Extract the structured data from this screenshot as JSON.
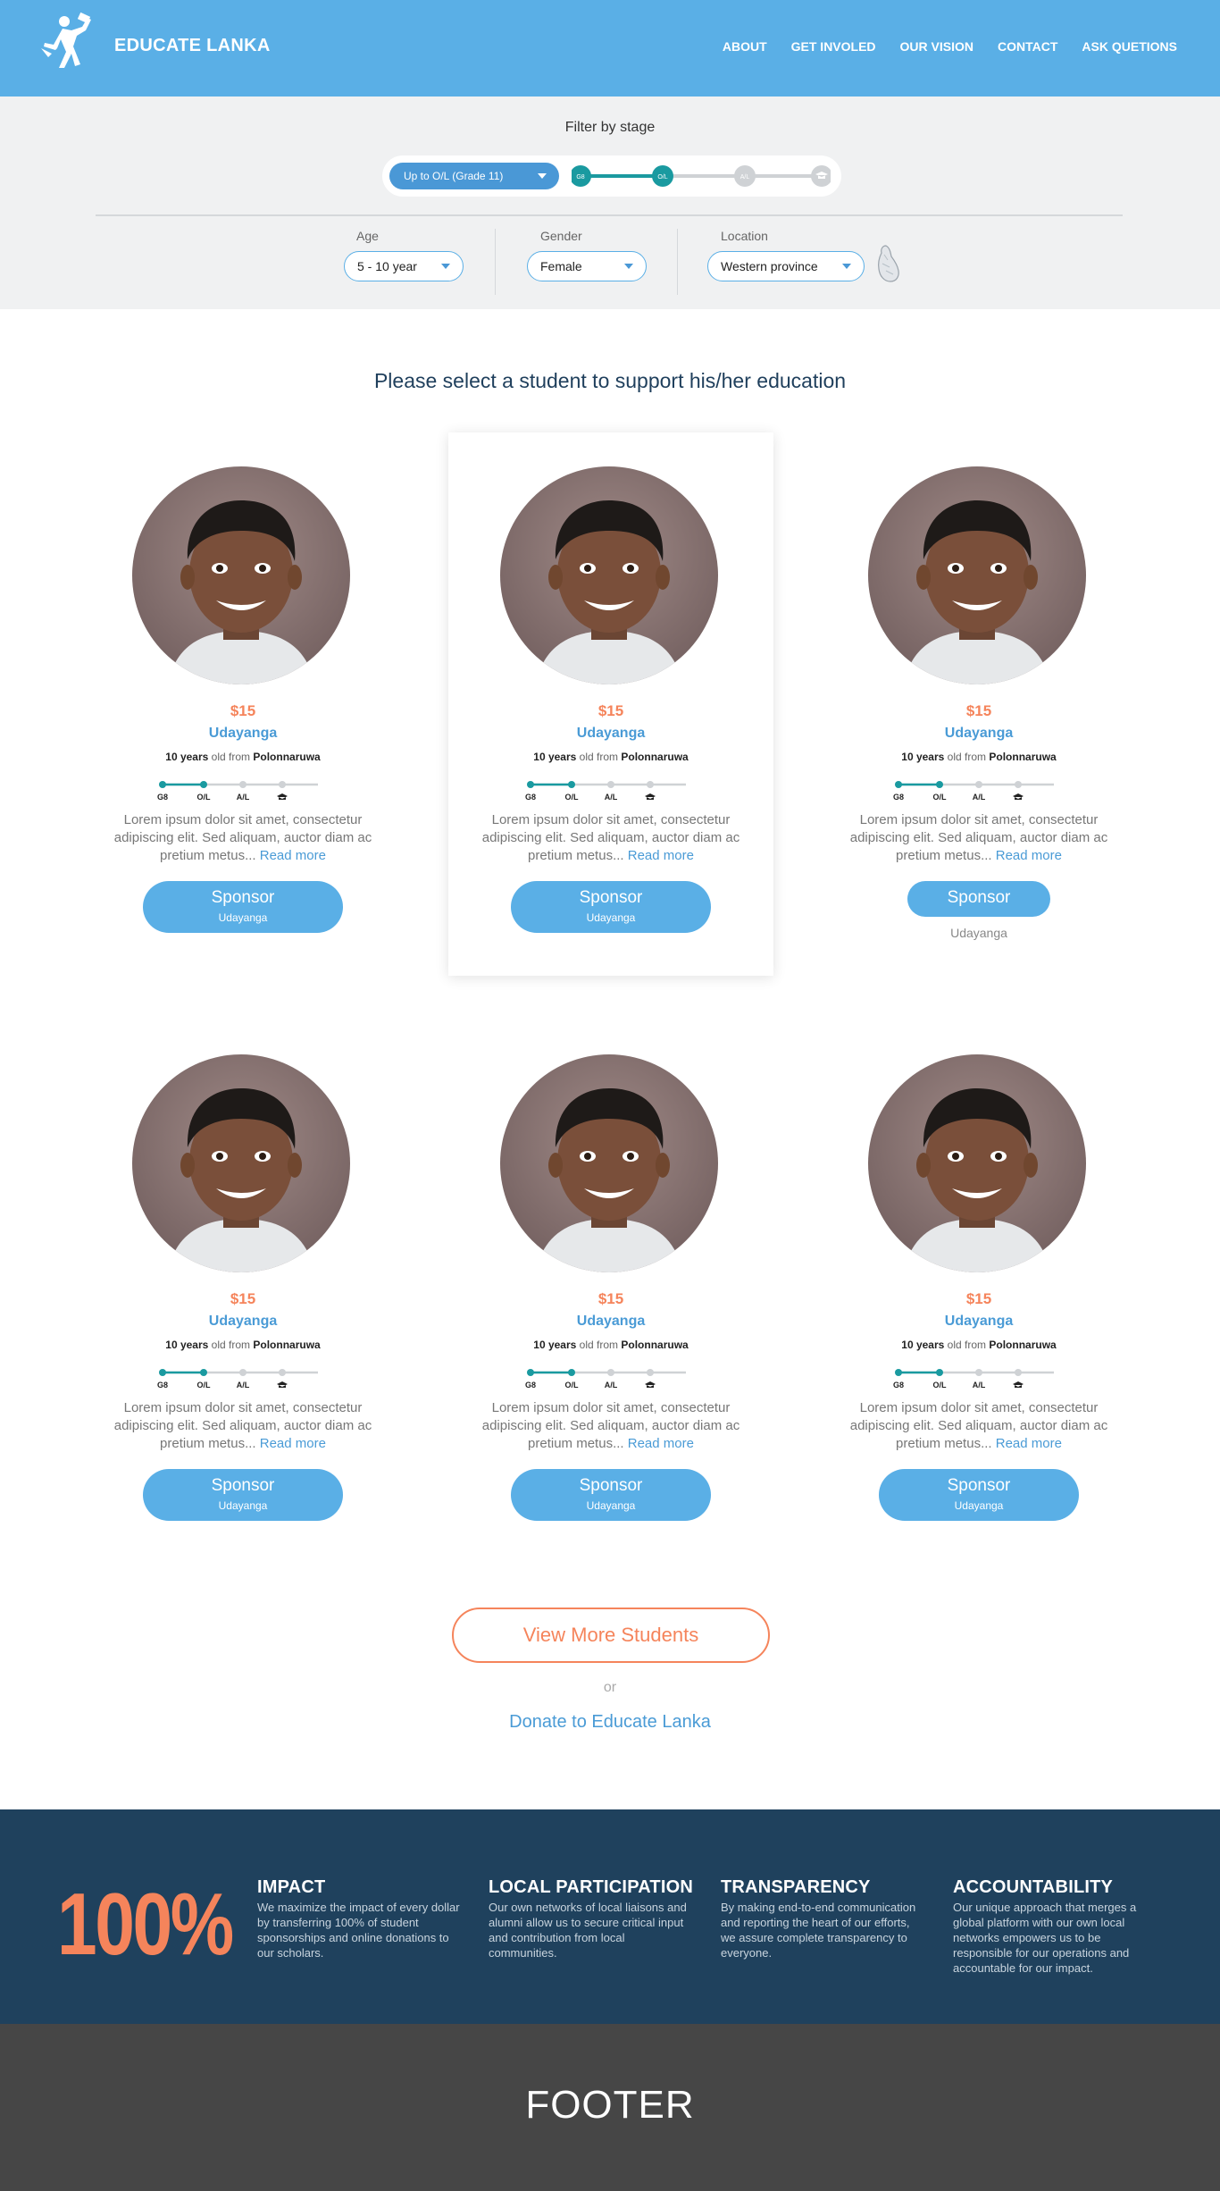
{
  "header": {
    "brand": "EDUCATE LANKA",
    "nav": [
      "ABOUT",
      "GET INVOLED",
      "OUR VISION",
      "CONTACT",
      "ASK QUETIONS"
    ]
  },
  "filter": {
    "title": "Filter by stage",
    "stage_select": "Up to O/L (Grade 11)",
    "stage_steps": [
      "G8",
      "O/L",
      "A/L",
      "graduation-cap-icon"
    ],
    "age_label": "Age",
    "age_value": "5 - 10 year",
    "gender_label": "Gender",
    "gender_value": "Female",
    "location_label": "Location",
    "location_value": "Western province"
  },
  "main": {
    "heading": "Please select a student to support his/her education",
    "students": [
      {
        "price": "$15",
        "name": "Udayanga",
        "age": "10 years",
        "old_from": "old from",
        "place": "Polonnaruwa",
        "desc": "Lorem ipsum dolor sit amet, consectetur adipiscing elit. Sed  aliquam, auctor diam ac pretium metus...",
        "read_more": "Read more",
        "sponsor": "Sponsor",
        "sponsor_sub": "Udayanga"
      },
      {
        "price": "$15",
        "name": "Udayanga",
        "age": "10 years",
        "old_from": "old from",
        "place": "Polonnaruwa",
        "desc": "Lorem ipsum dolor sit amet, consectetur adipiscing elit. Sed  aliquam, auctor diam ac pretium metus...",
        "read_more": "Read more",
        "sponsor": "Sponsor",
        "sponsor_sub": "Udayanga"
      },
      {
        "price": "$15",
        "name": "Udayanga",
        "age": "10 years",
        "old_from": "old from",
        "place": "Polonnaruwa",
        "desc": "Lorem ipsum dolor sit amet, consectetur adipiscing elit. Sed  aliquam, auctor diam ac pretium metus...",
        "read_more": "Read more",
        "sponsor": "Sponsor",
        "sponsor_sub": "Udayanga"
      },
      {
        "price": "$15",
        "name": "Udayanga",
        "age": "10 years",
        "old_from": "old from",
        "place": "Polonnaruwa",
        "desc": "Lorem ipsum dolor sit amet, consectetur adipiscing elit. Sed  aliquam, auctor diam ac pretium metus...",
        "read_more": "Read more",
        "sponsor": "Sponsor",
        "sponsor_sub": "Udayanga"
      },
      {
        "price": "$15",
        "name": "Udayanga",
        "age": "10 years",
        "old_from": "old from",
        "place": "Polonnaruwa",
        "desc": "Lorem ipsum dolor sit amet, consectetur adipiscing elit. Sed  aliquam, auctor diam ac pretium metus...",
        "read_more": "Read more",
        "sponsor": "Sponsor",
        "sponsor_sub": "Udayanga"
      },
      {
        "price": "$15",
        "name": "Udayanga",
        "age": "10 years",
        "old_from": "old from",
        "place": "Polonnaruwa",
        "desc": "Lorem ipsum dolor sit amet, consectetur adipiscing elit. Sed  aliquam, auctor diam ac pretium metus...",
        "read_more": "Read more",
        "sponsor": "Sponsor",
        "sponsor_sub": "Udayanga"
      }
    ],
    "view_more": "View More Students",
    "or": "or",
    "donate": "Donate to Educate Lanka"
  },
  "values": {
    "percent": "100%",
    "items": [
      {
        "title": "IMPACT",
        "text": "We maximize the impact of every dollar by transferring 100% of student sponsorships and online donations to our scholars."
      },
      {
        "title": "LOCAL PARTICIPATION",
        "text": "Our own networks of local liaisons and alumni allow us to secure critical input and contribution from local communities."
      },
      {
        "title": "TRANSPARENCY",
        "text": "By making end-to-end communication and reporting the heart of our efforts, we assure complete transparency to everyone."
      },
      {
        "title": "ACCOUNTABILITY",
        "text": "Our unique approach that merges a global platform with our own local networks empowers us to be responsible for our operations and accountable for our impact."
      }
    ]
  },
  "footer": {
    "text": "FOOTER"
  },
  "colors": {
    "header_blue": "#5aafe6",
    "accent_orange": "#f5845b",
    "teal": "#1a9aa0",
    "navy": "#1f415d",
    "footer_gray": "#464646"
  }
}
